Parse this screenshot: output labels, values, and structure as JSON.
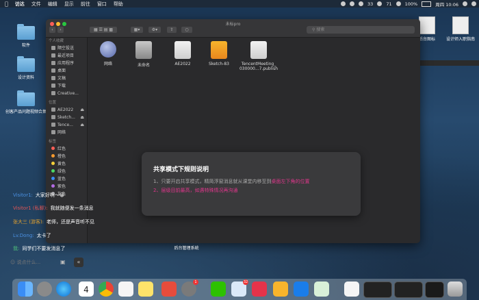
{
  "menubar": {
    "app": "访达",
    "items": [
      "文件",
      "编辑",
      "显示",
      "前往",
      "窗口",
      "帮助"
    ],
    "battery": "100%",
    "clock": "周四 10:06",
    "num1": "33",
    "num2": "71"
  },
  "desktop": {
    "items": [
      "软件",
      "设计资料",
      "创客产品问题视频合集"
    ],
    "right_items": [
      "后台图标",
      "设计师入职指南"
    ]
  },
  "finder": {
    "title": "未标pro",
    "search_placeholder": "搜索",
    "sidebar": {
      "sections": [
        {
          "title": "个人收藏",
          "items": [
            "隔空投送",
            "最近项目",
            "应用程序",
            "桌面",
            "文稿",
            "下载",
            "Creative..."
          ]
        },
        {
          "title": "位置",
          "items": [
            "AE2022",
            "Sketch...",
            "Tence...",
            "网络"
          ]
        },
        {
          "title": "标签",
          "items": [
            "红色",
            "橙色",
            "黄色",
            "绿色",
            "蓝色",
            "紫色",
            "灰色"
          ]
        }
      ]
    },
    "files": [
      {
        "name": "网络",
        "line2": ""
      },
      {
        "name": "未命名",
        "line2": ""
      },
      {
        "name": "AE2022",
        "line2": ""
      },
      {
        "name": "Sketch-83",
        "line2": ""
      },
      {
        "name": "TencentMeeting_",
        "line2": "030000...7.publish"
      }
    ]
  },
  "modal": {
    "title": "共享模式下规则说明",
    "line1_a": "1、只要开启共享模式，精简浮窗消息就从课堂内移至到",
    "line1_b": "桌面左下角的位置",
    "line2": "2、层级目前最高，如遇特殊情况再沟通"
  },
  "chat": [
    {
      "who": "Visitor1:",
      "msg": "大家好啊～😀",
      "who_color": "#4a90e2"
    },
    {
      "who": "Visitor1 (私聊):",
      "msg": "我就随便发一条消息",
      "who_color": "#e05555"
    },
    {
      "who": "张大三 (游客):",
      "msg": "老师，还是声音听不见",
      "who_color": "#e0a030"
    },
    {
      "who": "Lv.Dong:",
      "msg": "太卡了",
      "who_color": "#4a90e2"
    },
    {
      "who": "我:",
      "msg": "同学们不要发消息了",
      "who_color": "#4ec07a"
    }
  ],
  "chat_input": {
    "placeholder": "说点什么..."
  },
  "tooltip": {
    "label": "后台管理系统"
  },
  "dock": {
    "calendar_day": "4",
    "badge1": "1",
    "badge2": "32"
  }
}
